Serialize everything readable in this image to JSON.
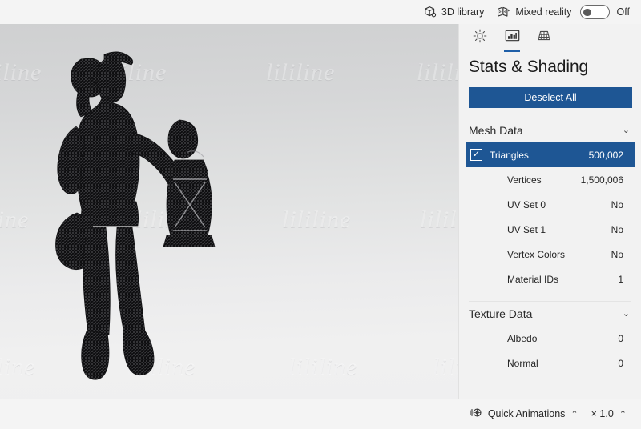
{
  "topbar": {
    "library_label": "3D library",
    "library_icon": "cube-3d-icon",
    "mixed_reality_label": "Mixed reality",
    "mixed_reality_icon": "mixed-reality-icon",
    "toggle_state_label": "Off"
  },
  "tabs": [
    {
      "name": "lighting",
      "icon": "sun-brightness-icon",
      "active": false
    },
    {
      "name": "stats-shading",
      "icon": "stats-shading-icon",
      "active": true
    },
    {
      "name": "grid",
      "icon": "grid-icon",
      "active": false
    }
  ],
  "panel": {
    "title": "Stats & Shading",
    "deselect_label": "Deselect All"
  },
  "sections": [
    {
      "title": "Mesh Data",
      "chevron": "⌄",
      "rows": [
        {
          "label": "Triangles",
          "value": "500,002",
          "selected": true,
          "checked": true
        },
        {
          "label": "Vertices",
          "value": "1,500,006",
          "selected": false,
          "checked": false
        },
        {
          "label": "UV Set 0",
          "value": "No",
          "selected": false,
          "checked": false
        },
        {
          "label": "UV Set 1",
          "value": "No",
          "selected": false,
          "checked": false
        },
        {
          "label": "Vertex Colors",
          "value": "No",
          "selected": false,
          "checked": false
        },
        {
          "label": "Material IDs",
          "value": "1",
          "selected": false,
          "checked": false
        }
      ]
    },
    {
      "title": "Texture Data",
      "chevron": "⌄",
      "rows": [
        {
          "label": "Albedo",
          "value": "0",
          "selected": false,
          "checked": false
        },
        {
          "label": "Normal",
          "value": "0",
          "selected": false,
          "checked": false
        }
      ]
    }
  ],
  "bottombar": {
    "quick_animations_label": "Quick Animations",
    "quick_animations_icon": "animation-icon",
    "quick_animations_chevron": "⌃",
    "speed_label": "× 1.0",
    "speed_chevron": "⌃"
  },
  "viewport": {
    "watermark_text": "lililine",
    "model_name": "miner-with-lantern-wireframe"
  },
  "colors": {
    "accent": "#1e5694",
    "panel_bg": "#f2f2f2",
    "chrome_bg": "#f4f4f4",
    "text": "#262626"
  }
}
